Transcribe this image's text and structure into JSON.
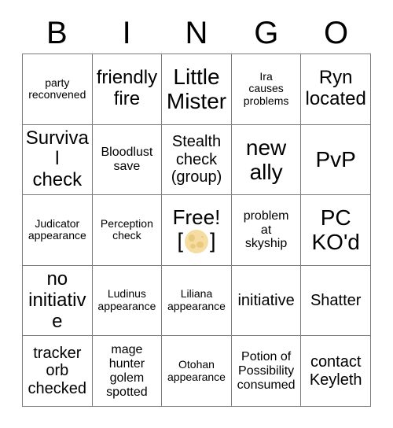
{
  "card": {
    "header_letters": [
      "B",
      "I",
      "N",
      "G",
      "O"
    ],
    "free_space": {
      "label": "Free!",
      "bracket_left": "[",
      "bracket_right": "]",
      "icon": "full-moon-emoji",
      "moon_color": "#f5dda2",
      "moon_crater_color": "#e8c97f"
    },
    "colors": {
      "background": "#ffffff",
      "text": "#000000",
      "grid_line": "#7b7b7b"
    },
    "rows": [
      [
        {
          "text": "party\nreconvened",
          "size": "fs-xs"
        },
        {
          "text": "friendly\nfire",
          "size": "fs-lg"
        },
        {
          "text": "Little\nMister",
          "size": "fs-xl"
        },
        {
          "text": "Ira\ncauses\nproblems",
          "size": "fs-xs"
        },
        {
          "text": "Ryn\nlocated",
          "size": "fs-lg"
        }
      ],
      [
        {
          "text": "Survival\ncheck",
          "size": "fs-lg"
        },
        {
          "text": "Bloodlust\nsave",
          "size": "fs-sm"
        },
        {
          "text": "Stealth\ncheck\n(group)",
          "size": "fs-md"
        },
        {
          "text": "new\nally",
          "size": "fs-xl"
        },
        {
          "text": "PvP",
          "size": "fs-xl"
        }
      ],
      [
        {
          "text": "Judicator\nappearance",
          "size": "fs-xs"
        },
        {
          "text": "Perception\ncheck",
          "size": "fs-xs"
        },
        {
          "text": "FREE_SPACE",
          "size": "fs-xl"
        },
        {
          "text": "problem\nat\nskyship",
          "size": "fs-sm"
        },
        {
          "text": "PC\nKO'd",
          "size": "fs-xl"
        }
      ],
      [
        {
          "text": "no\ninitiative",
          "size": "fs-lg"
        },
        {
          "text": "Ludinus\nappearance",
          "size": "fs-xs"
        },
        {
          "text": "Liliana\nappearance",
          "size": "fs-xs"
        },
        {
          "text": "initiative",
          "size": "fs-md"
        },
        {
          "text": "Shatter",
          "size": "fs-md"
        }
      ],
      [
        {
          "text": "tracker\norb\nchecked",
          "size": "fs-md"
        },
        {
          "text": "mage\nhunter\ngolem\nspotted",
          "size": "fs-sm"
        },
        {
          "text": "Otohan\nappearance",
          "size": "fs-xs"
        },
        {
          "text": "Potion of\nPossibility\nconsumed",
          "size": "fs-sm"
        },
        {
          "text": "contact\nKeyleth",
          "size": "fs-md"
        }
      ]
    ]
  }
}
